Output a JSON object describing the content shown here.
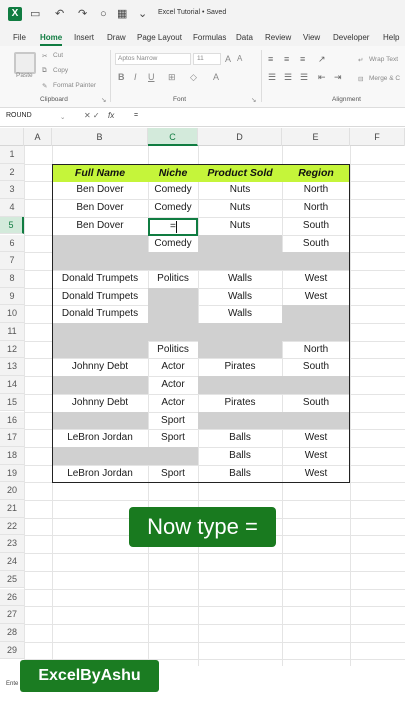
{
  "titlebar": {
    "logo": "X",
    "doc_title": "Excel Tutorial • Saved",
    "icons": [
      "save-icon",
      "undo-icon",
      "redo-icon",
      "circle-icon",
      "calendar-icon",
      "dropdown-icon"
    ]
  },
  "tabs": [
    "File",
    "Home",
    "Insert",
    "Draw",
    "Page Layout",
    "Formulas",
    "Data",
    "Review",
    "View",
    "Developer",
    "Help"
  ],
  "ribbon": {
    "paste": "Paste",
    "cut": "Cut",
    "copy": "Copy",
    "format_painter": "Format Painter",
    "clipboard_label": "Clipboard",
    "font_name": "Aptos Narrow",
    "font_size": "11",
    "font_label": "Font",
    "wrap_text": "Wrap Text",
    "merge": "Merge & C",
    "alignment_label": "Alignment"
  },
  "formula_bar": {
    "name_box": "ROUND",
    "fx": "fx",
    "value": "="
  },
  "columns": [
    "A",
    "B",
    "C",
    "D",
    "E",
    "F"
  ],
  "rows": [
    "1",
    "2",
    "3",
    "4",
    "5",
    "6",
    "7",
    "8",
    "9",
    "10",
    "11",
    "12",
    "13",
    "14",
    "15",
    "16",
    "17",
    "18",
    "19",
    "20",
    "21",
    "22",
    "23",
    "24",
    "25",
    "26",
    "27",
    "28",
    "29"
  ],
  "table": {
    "headers": [
      "Full Name",
      "Niche",
      "Product Sold",
      "Region"
    ],
    "rows": [
      [
        "Ben Dover",
        "Comedy",
        "Nuts",
        "North"
      ],
      [
        "Ben Dover",
        "Comedy",
        "Nuts",
        "North"
      ],
      [
        "Ben Dover",
        "=",
        "Nuts",
        "South"
      ],
      [
        "",
        "Comedy",
        "",
        "South"
      ],
      [
        "",
        "",
        "",
        ""
      ],
      [
        "Donald Trumpets",
        "Politics",
        "Walls",
        "West"
      ],
      [
        "Donald Trumpets",
        "",
        "Walls",
        "West"
      ],
      [
        "Donald Trumpets",
        "",
        "Walls",
        ""
      ],
      [
        "",
        "",
        "",
        ""
      ],
      [
        "",
        "Politics",
        "",
        "North"
      ],
      [
        "Johnny Debt",
        "Actor",
        "Pirates",
        "South"
      ],
      [
        "",
        "Actor",
        "",
        ""
      ],
      [
        "Johnny Debt",
        "Actor",
        "Pirates",
        "South"
      ],
      [
        "",
        "Sport",
        "",
        ""
      ],
      [
        "LeBron Jordan",
        "Sport",
        "Balls",
        "West"
      ],
      [
        "",
        "",
        "Balls",
        "West"
      ],
      [
        "LeBron Jordan",
        "Sport",
        "Balls",
        "West"
      ]
    ]
  },
  "caption": "Now type =",
  "brand": "ExcelByAshu",
  "status": "Ente",
  "colors": {
    "header_fill": "#c5f53a",
    "blank_fill": "#d0d0d0",
    "excel_green": "#107c41",
    "caption_bg": "#197a1f"
  }
}
